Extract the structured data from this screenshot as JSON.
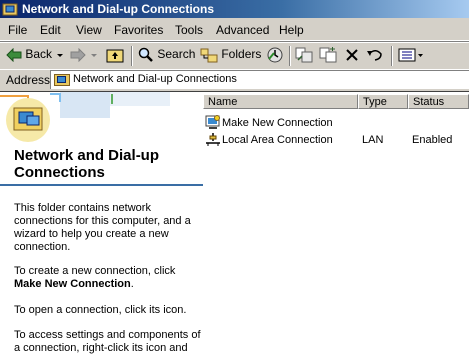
{
  "window": {
    "title": "Network and Dial-up Connections"
  },
  "menu": [
    "File",
    "Edit",
    "View",
    "Favorites",
    "Tools",
    "Advanced",
    "Help"
  ],
  "toolbar": {
    "back_label": "Back",
    "search_label": "Search",
    "folders_label": "Folders"
  },
  "address": {
    "label": "Address",
    "value": "Network and Dial-up Connections"
  },
  "left_pane": {
    "title": "Network and Dial-up Connections",
    "p1": "This folder contains network connections for this computer, and a wizard to help you create a new connection.",
    "p2_text": "To create a new connection, click",
    "p2_bold": "Make New Connection",
    "p2_end": ".",
    "p3": "To open a connection, click its icon.",
    "p4": "To access settings and components of a connection, right-click its icon and"
  },
  "list": {
    "columns": [
      "Name",
      "Type",
      "Status"
    ],
    "rows": [
      {
        "name": "Make New Connection",
        "type": "",
        "status": "",
        "icon": "make-new-connection-icon"
      },
      {
        "name": "Local Area Connection",
        "type": "LAN",
        "status": "Enabled",
        "icon": "lan-connection-icon"
      }
    ]
  },
  "colors": {
    "title_start": "#0a246a",
    "title_end": "#a6caf0",
    "accent": "#3a6ea5"
  }
}
